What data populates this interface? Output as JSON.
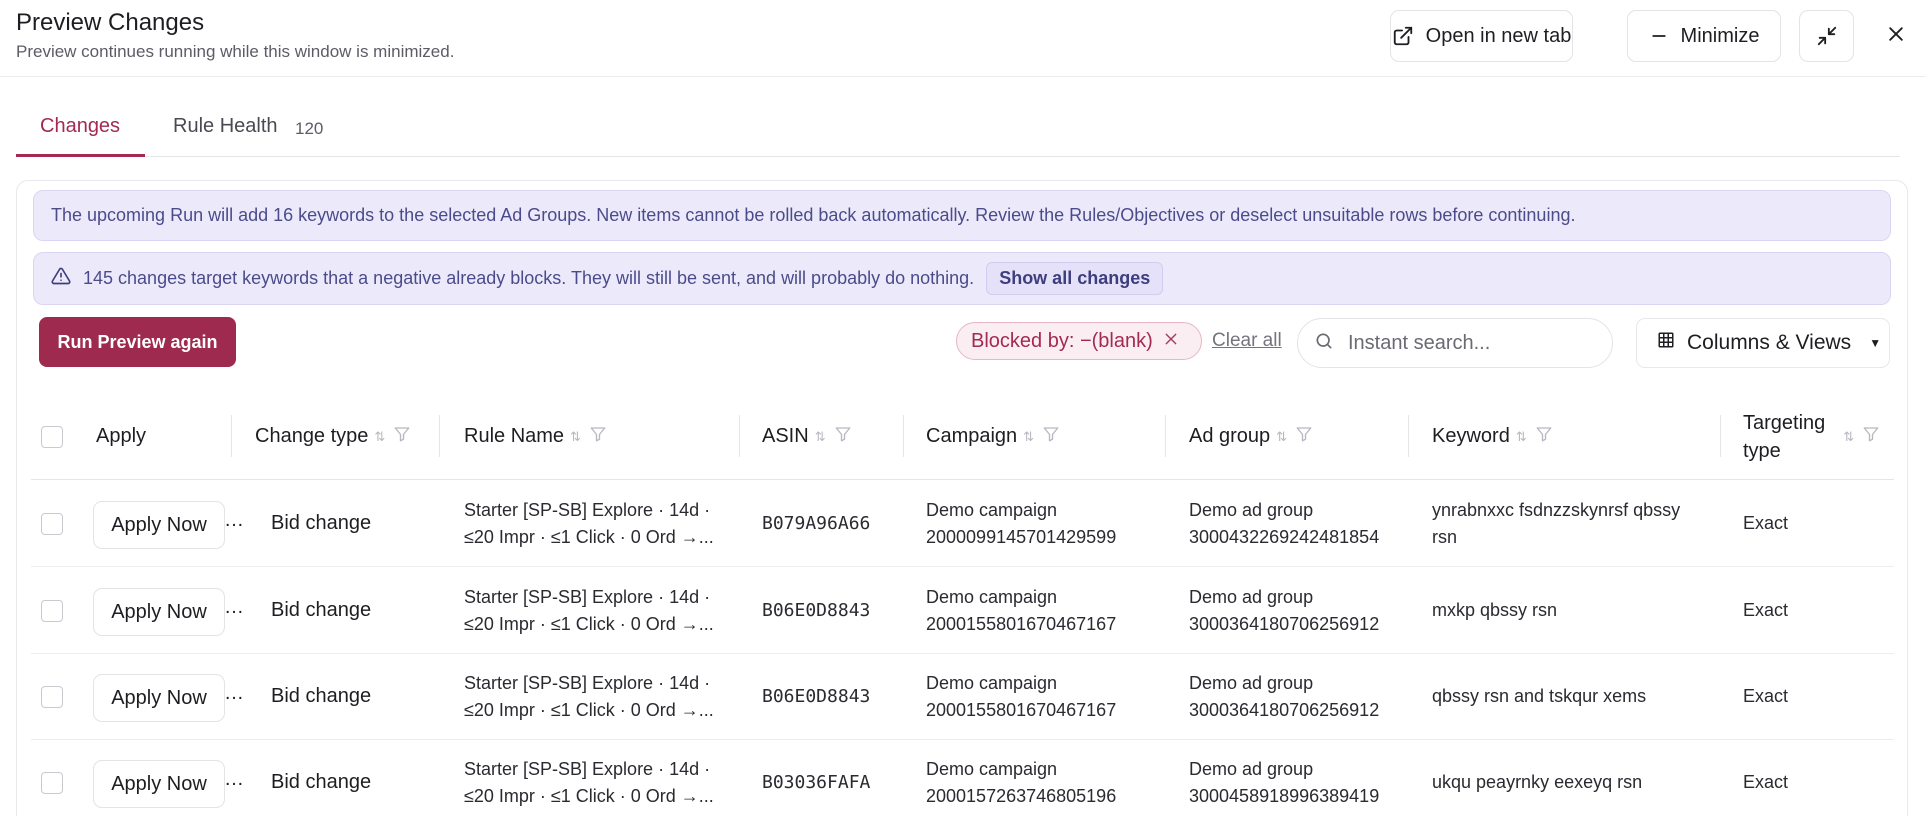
{
  "window": {
    "title": "Preview Changes",
    "subtitle": "Preview continues running while this window is minimized.",
    "open_new_tab_label": "Open in new tab",
    "minimize_label": "Minimize"
  },
  "tabs": [
    {
      "label": "Changes",
      "active": true
    },
    {
      "label": "Rule Health",
      "count": "120",
      "active": false
    }
  ],
  "notices": {
    "run_notice": "The upcoming Run will add 16 keywords to the selected Ad Groups. New items cannot be rolled back automatically. Review the Rules/Objectives or deselect unsuitable rows before continuing.",
    "negative_notice": "145 changes target keywords that a negative already blocks. They will still be sent, and will probably do nothing.",
    "show_all_label": "Show all changes"
  },
  "toolbar": {
    "run_preview_label": "Run Preview again",
    "filter_chip_label": "Blocked by: −(blank)",
    "clear_all_label": "Clear all",
    "search_placeholder": "Instant search...",
    "columns_label": "Columns & Views"
  },
  "columns": {
    "apply": "Apply",
    "change_type": "Change type",
    "rule_name": "Rule Name",
    "asin": "ASIN",
    "campaign": "Campaign",
    "ad_group": "Ad group",
    "keyword": "Keyword",
    "targeting_type_1": "Targeting",
    "targeting_type_2": "type"
  },
  "rows": [
    {
      "apply_label": "Apply Now",
      "change_type": "Bid change",
      "rule_line1": "Starter [SP-SB] Explore · 14d ·",
      "rule_line2": "≤20 Impr · ≤1 Click · 0 Ord →...",
      "asin": "B079A96A66",
      "campaign_name": "Demo campaign",
      "campaign_id": "2000099145701429599",
      "ad_group_name": "Demo ad group",
      "ad_group_id": "3000432269242481854",
      "keyword_line1": "ynrabnxxc fsdnzzskynrsf qbssy",
      "keyword_line2": "rsn",
      "targeting_type": "Exact"
    },
    {
      "apply_label": "Apply Now",
      "change_type": "Bid change",
      "rule_line1": "Starter [SP-SB] Explore · 14d ·",
      "rule_line2": "≤20 Impr · ≤1 Click · 0 Ord →...",
      "asin": "B06E0D8843",
      "campaign_name": "Demo campaign",
      "campaign_id": "2000155801670467167",
      "ad_group_name": "Demo ad group",
      "ad_group_id": "3000364180706256912",
      "keyword_line1": "mxkp qbssy rsn",
      "keyword_line2": "",
      "targeting_type": "Exact"
    },
    {
      "apply_label": "Apply Now",
      "change_type": "Bid change",
      "rule_line1": "Starter [SP-SB] Explore · 14d ·",
      "rule_line2": "≤20 Impr · ≤1 Click · 0 Ord →...",
      "asin": "B06E0D8843",
      "campaign_name": "Demo campaign",
      "campaign_id": "2000155801670467167",
      "ad_group_name": "Demo ad group",
      "ad_group_id": "3000364180706256912",
      "keyword_line1": "qbssy rsn and tskqur xems",
      "keyword_line2": "",
      "targeting_type": "Exact"
    },
    {
      "apply_label": "Apply Now",
      "change_type": "Bid change",
      "rule_line1": "Starter [SP-SB] Explore · 14d ·",
      "rule_line2": "≤20 Impr · ≤1 Click · 0 Ord →...",
      "asin": "B03036FAFA",
      "campaign_name": "Demo campaign",
      "campaign_id": "2000157263746805196",
      "ad_group_name": "Demo ad group",
      "ad_group_id": "3000458918996389419",
      "keyword_line1": "ukqu peayrnky eexeyq rsn",
      "keyword_line2": "",
      "targeting_type": "Exact"
    }
  ],
  "colors": {
    "accent": "#a32a54",
    "primary_button": "#9f2a4f",
    "notice_bg": "#eceafa",
    "notice_text": "#4b4b8c"
  },
  "icons": {
    "open_new_tab": "external-link-icon",
    "minimize": "minus-icon",
    "collapse": "collapse-arrows-icon",
    "close": "close-icon",
    "warning": "warning-triangle-icon",
    "search": "search-icon",
    "columns": "grid-icon",
    "sort": "sort-icon",
    "filter": "filter-icon"
  }
}
